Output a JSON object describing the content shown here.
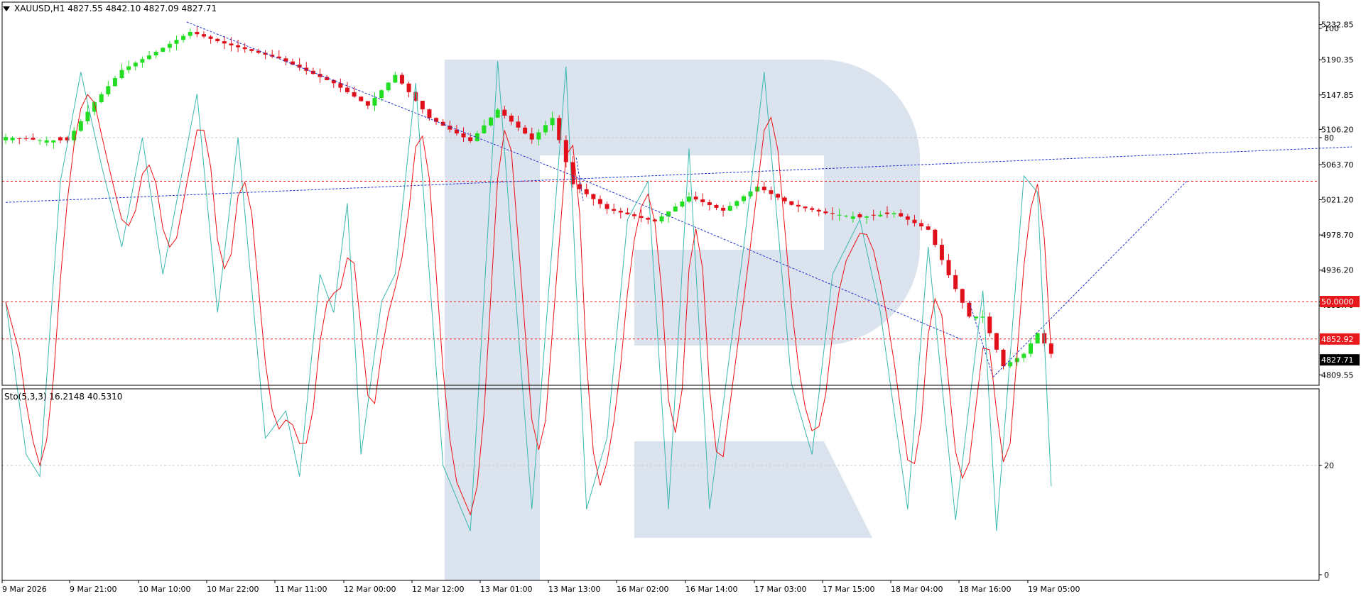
{
  "header": {
    "main": "XAUUSD,H1  4827.55 4842.10 4827.09 4827.71",
    "sub": "Sto(5,3,3) 16.2148 40.5310"
  },
  "colors": {
    "bull": "#22dd22",
    "bear": "#e0101a",
    "trend": "#2233cc",
    "level": "#ee2222",
    "k_line": "#3ab8b0",
    "d_line": "#ee1111",
    "watermark": "#dbe3ee",
    "price_tag": "#e8191d",
    "current_tag": "#000000"
  },
  "chart_data": [
    {
      "type": "candlestick",
      "title": "XAUUSD,H1",
      "ohlc_last": {
        "open": 4827.55,
        "high": 4842.1,
        "low": 4827.09,
        "close": 4827.71
      },
      "y_ticks": [
        5232.85,
        5190.35,
        5147.85,
        5106.2,
        5063.7,
        5021.2,
        4978.7,
        4936.2,
        4893.7,
        4809.55
      ],
      "ylim": [
        4797,
        5260
      ],
      "x_ticks": [
        "9 Mar 2026",
        "9 Mar 21:00",
        "10 Mar 10:00",
        "10 Mar 22:00",
        "11 Mar 11:00",
        "12 Mar 00:00",
        "12 Mar 12:00",
        "13 Mar 01:00",
        "13 Mar 13:00",
        "16 Mar 02:00",
        "16 Mar 14:00",
        "17 Mar 03:00",
        "17 Mar 15:00",
        "18 Mar 04:00",
        "18 Mar 16:00",
        "19 Mar 05:00"
      ],
      "levels": [
        {
          "value": 5043.5,
          "color": "#ee2222"
        },
        {
          "value": 4852.92,
          "label": "4852.92",
          "color": "#ee2222"
        }
      ],
      "current_price": "4827.71",
      "anchors": [
        {
          "i": 0,
          "p": 5097
        },
        {
          "i": 5,
          "p": 5093
        },
        {
          "i": 9,
          "p": 5093
        },
        {
          "i": 13,
          "p": 5139
        },
        {
          "i": 17,
          "p": 5178
        },
        {
          "i": 22,
          "p": 5200
        },
        {
          "i": 27,
          "p": 5224
        },
        {
          "i": 32,
          "p": 5210
        },
        {
          "i": 40,
          "p": 5192
        },
        {
          "i": 48,
          "p": 5162
        },
        {
          "i": 53,
          "p": 5135
        },
        {
          "i": 57,
          "p": 5172
        },
        {
          "i": 62,
          "p": 5120
        },
        {
          "i": 68,
          "p": 5092
        },
        {
          "i": 72,
          "p": 5130
        },
        {
          "i": 77,
          "p": 5094
        },
        {
          "i": 80,
          "p": 5120
        },
        {
          "i": 83,
          "p": 5040
        },
        {
          "i": 88,
          "p": 5010
        },
        {
          "i": 95,
          "p": 4995
        },
        {
          "i": 100,
          "p": 5025
        },
        {
          "i": 105,
          "p": 5008
        },
        {
          "i": 110,
          "p": 5037
        },
        {
          "i": 115,
          "p": 5015
        },
        {
          "i": 120,
          "p": 5005
        },
        {
          "i": 125,
          "p": 5000
        },
        {
          "i": 130,
          "p": 5005
        },
        {
          "i": 135,
          "p": 4985
        },
        {
          "i": 138,
          "p": 4930
        },
        {
          "i": 141,
          "p": 4880
        },
        {
          "i": 143,
          "p": 4880
        },
        {
          "i": 146,
          "p": 4820
        },
        {
          "i": 149,
          "p": 4835
        },
        {
          "i": 151,
          "p": 4860
        },
        {
          "i": 153,
          "p": 4835
        }
      ],
      "trendlines": [
        {
          "x1": 26.5,
          "y1": 5236,
          "x2": 84,
          "y2": 5047
        },
        {
          "x1": 84,
          "y1": 5047,
          "x2": 140,
          "y2": 4852
        },
        {
          "x1": 0,
          "y1": 5018,
          "x2": 197,
          "y2": 5085
        },
        {
          "x1": 144.5,
          "y1": 4807,
          "x2": 173,
          "y2": 5045
        },
        {
          "x1": 141,
          "y1": 4898,
          "x2": 144.5,
          "y2": 4807
        },
        {
          "x1": 83.5,
          "y1": 5072,
          "x2": 84.5,
          "y2": 5020
        }
      ]
    },
    {
      "type": "line",
      "title": "Sto(5,3,3)",
      "series": [
        {
          "name": "Sto(5,3,3) %K",
          "last": 16.2148
        },
        {
          "name": "Sto(5,3,3) %D",
          "last": 40.531
        }
      ],
      "ylim": [
        0,
        100
      ],
      "y_ticks": [
        100,
        80,
        50,
        20,
        0
      ],
      "levels": [
        {
          "value": 80
        },
        {
          "value": 50,
          "label": "50.0000"
        },
        {
          "value": 20
        }
      ],
      "k_anchors": [
        {
          "i": 0,
          "v": 50
        },
        {
          "i": 3,
          "v": 22
        },
        {
          "i": 5,
          "v": 18
        },
        {
          "i": 8,
          "v": 72
        },
        {
          "i": 11,
          "v": 92
        },
        {
          "i": 14,
          "v": 75
        },
        {
          "i": 17,
          "v": 60
        },
        {
          "i": 20,
          "v": 80
        },
        {
          "i": 23,
          "v": 55
        },
        {
          "i": 28,
          "v": 88
        },
        {
          "i": 31,
          "v": 48
        },
        {
          "i": 34,
          "v": 80
        },
        {
          "i": 38,
          "v": 25
        },
        {
          "i": 41,
          "v": 30
        },
        {
          "i": 43,
          "v": 18
        },
        {
          "i": 46,
          "v": 55
        },
        {
          "i": 48,
          "v": 48
        },
        {
          "i": 50,
          "v": 68
        },
        {
          "i": 52,
          "v": 22
        },
        {
          "i": 55,
          "v": 50
        },
        {
          "i": 57,
          "v": 55
        },
        {
          "i": 60,
          "v": 90
        },
        {
          "i": 64,
          "v": 20
        },
        {
          "i": 68,
          "v": 8
        },
        {
          "i": 72,
          "v": 94
        },
        {
          "i": 77,
          "v": 12
        },
        {
          "i": 82,
          "v": 93
        },
        {
          "i": 85,
          "v": 12
        },
        {
          "i": 88,
          "v": 25
        },
        {
          "i": 91,
          "v": 65
        },
        {
          "i": 94,
          "v": 72
        },
        {
          "i": 97,
          "v": 12
        },
        {
          "i": 100,
          "v": 78
        },
        {
          "i": 103,
          "v": 12
        },
        {
          "i": 108,
          "v": 60
        },
        {
          "i": 111,
          "v": 92
        },
        {
          "i": 115,
          "v": 35
        },
        {
          "i": 118,
          "v": 22
        },
        {
          "i": 121,
          "v": 55
        },
        {
          "i": 125,
          "v": 65
        },
        {
          "i": 128,
          "v": 48
        },
        {
          "i": 132,
          "v": 12
        },
        {
          "i": 135,
          "v": 60
        },
        {
          "i": 139,
          "v": 10
        },
        {
          "i": 143,
          "v": 52
        },
        {
          "i": 145,
          "v": 8
        },
        {
          "i": 147,
          "v": 40
        },
        {
          "i": 149,
          "v": 73
        },
        {
          "i": 151,
          "v": 70
        },
        {
          "i": 153,
          "v": 16.2148
        }
      ]
    }
  ]
}
